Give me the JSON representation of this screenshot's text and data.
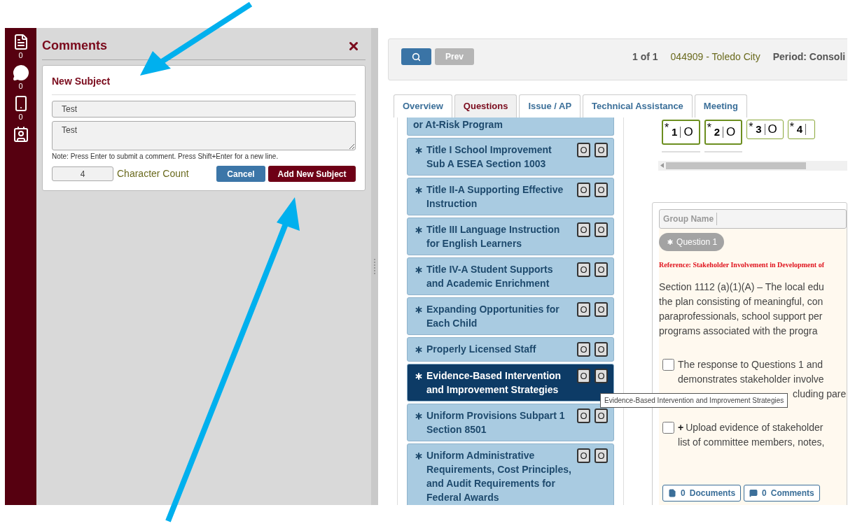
{
  "sidebar": {
    "items": [
      {
        "kind": "document",
        "count": "0"
      },
      {
        "kind": "comment",
        "count": "0"
      },
      {
        "kind": "phone",
        "count": "0"
      },
      {
        "kind": "contacts"
      }
    ]
  },
  "comments_panel": {
    "title": "Comments",
    "form": {
      "heading": "New Subject",
      "subject": "Test",
      "comment": "Test",
      "note": "Note: Press Enter to submit a comment. Press Shift+Enter for a new line.",
      "count": "4",
      "count_label": "Character Count",
      "cancel": "Cancel",
      "submit": "Add New Subject"
    }
  },
  "toolbar": {
    "prev": {
      "label": "Prev",
      "disabled": true
    },
    "page": "1 of 1",
    "district": "044909 - Toledo City",
    "period": "Period: Consoli"
  },
  "tabs": [
    {
      "label": "Overview",
      "selected": false
    },
    {
      "label": "Questions",
      "selected": true
    },
    {
      "label": "Issue / AP",
      "selected": false
    },
    {
      "label": "Technical Assistance",
      "selected": false
    },
    {
      "label": "Meeting",
      "selected": false
    }
  ],
  "sections": [
    {
      "kind": "partial",
      "title": "or At-Risk Program",
      "selected": false
    },
    {
      "kind": "section",
      "title": "Title I School Improvement Sub A ESEA Section 1003",
      "selected": false,
      "buttons": [
        "O",
        "O"
      ]
    },
    {
      "kind": "section",
      "title": "Title II-A Supporting Effective Instruction",
      "selected": false,
      "buttons": [
        "O",
        "O"
      ]
    },
    {
      "kind": "section",
      "title": "Title III Language Instruction for English Learners",
      "selected": false,
      "buttons": [
        "O",
        "O"
      ]
    },
    {
      "kind": "section",
      "title": "Title IV-A Student Supports and Academic Enrichment",
      "selected": false,
      "buttons": [
        "O",
        "O"
      ]
    },
    {
      "kind": "section",
      "title": "Expanding Opportunities for Each Child",
      "selected": false,
      "buttons": [
        "O",
        "O"
      ]
    },
    {
      "kind": "section",
      "title": "Properly Licensed Staff",
      "selected": false,
      "buttons": [
        "O",
        "O"
      ]
    },
    {
      "kind": "section",
      "title": "Evidence-Based Intervention and Improvement Strategies",
      "selected": true,
      "buttons": [
        "O",
        "O"
      ]
    },
    {
      "kind": "section",
      "title": "Uniform Provisions Subpart 1 Section 8501",
      "selected": false,
      "buttons": [
        "O",
        "O"
      ]
    },
    {
      "kind": "section",
      "title": "Uniform Administrative Requirements, Cost Principles, and Audit Requirements for Federal Awards",
      "selected": false,
      "buttons": [
        "O",
        "O"
      ]
    }
  ],
  "tooltip": "Evidence-Based Intervention and Improvement Strategies",
  "question_numbers": [
    {
      "flag": "*",
      "number": "1",
      "status": "O",
      "selected": true
    },
    {
      "flag": "*",
      "number": "2",
      "status": "O",
      "selected": true
    },
    {
      "flag": "*",
      "number": "3",
      "status": "O",
      "selected": false
    },
    {
      "flag": "*",
      "number": "4",
      "selected": false
    }
  ],
  "question": {
    "group_placeholder": "Group Name",
    "badge": "Question 1",
    "reference": "Reference: Stakeholder Involvement in Development of",
    "text_lines": [
      "Section 1112 (a)(1)(A) – The local edu",
      "the plan consisting of meaningful, con",
      "paraprofessionals, school support per",
      "programs associated with the progra"
    ],
    "checklist": [
      {
        "checked": false,
        "lines": [
          "The response to Questions 1 and",
          "demonstrates stakeholder involve"
        ],
        "covered_line": "cluding pare"
      },
      {
        "checked": false,
        "plus": "+",
        "lines": [
          "Upload evidence of stakeholder",
          "list of committee members, notes,"
        ]
      }
    ],
    "buttons": [
      {
        "kind": "documents",
        "count": "0",
        "label": "Documents"
      },
      {
        "kind": "comments",
        "count": "0",
        "label": "Comments"
      }
    ]
  }
}
